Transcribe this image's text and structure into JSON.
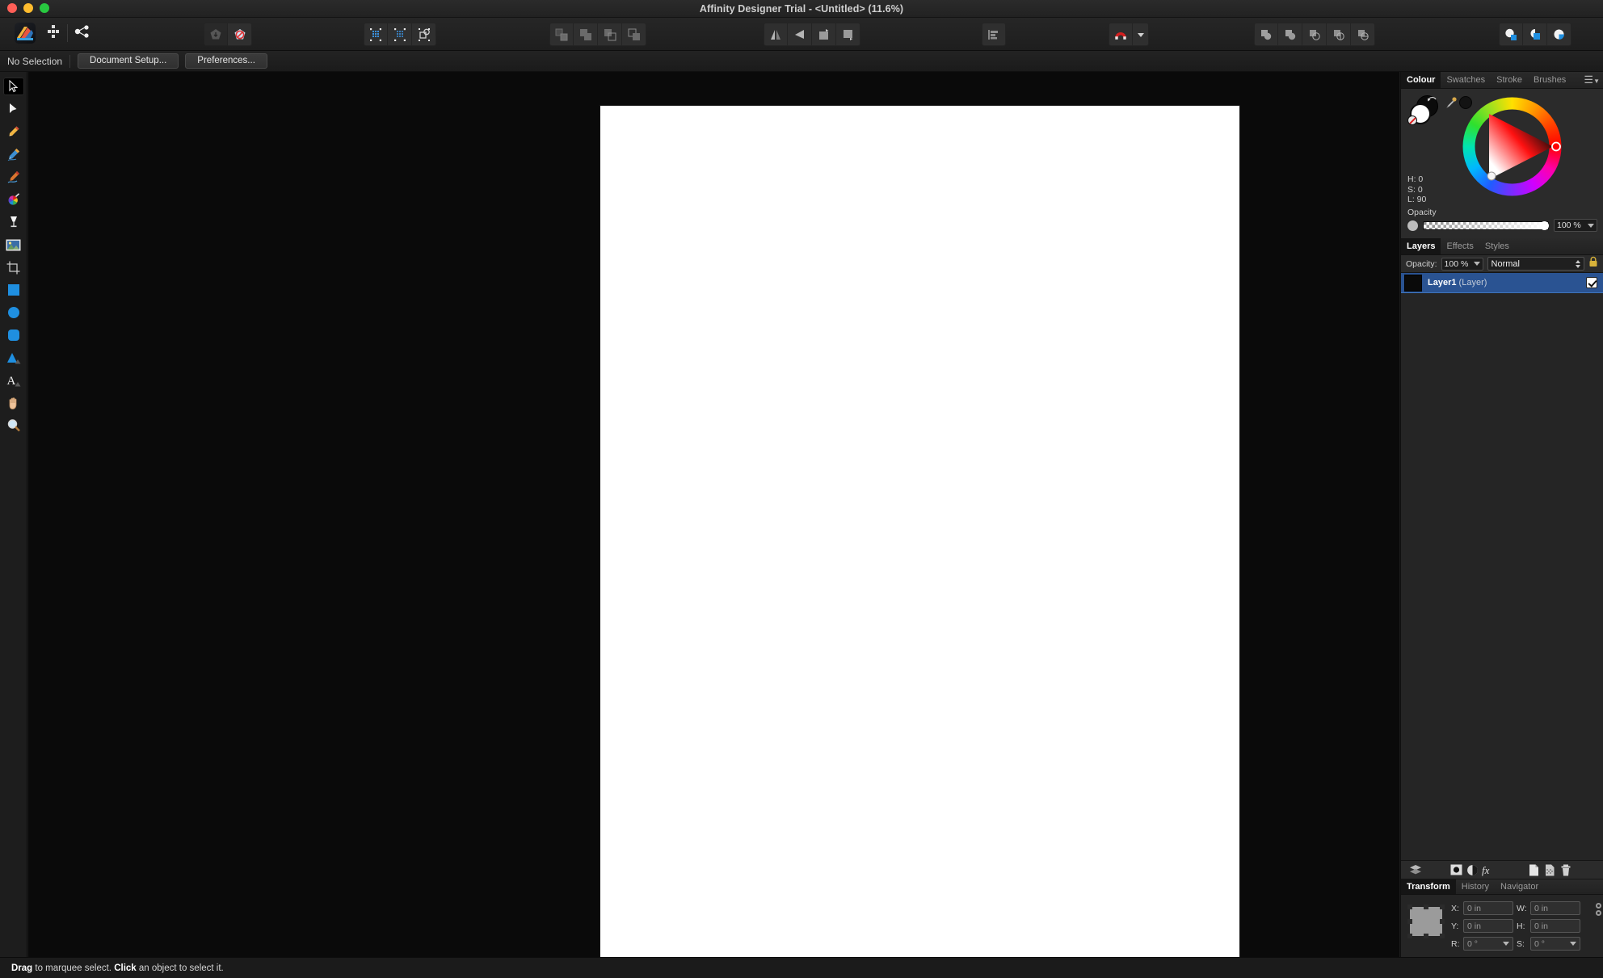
{
  "window": {
    "title": "Affinity Designer Trial - <Untitled> (11.6%)",
    "app_name": "Affinity Designer Trial",
    "document_name": "<Untitled>",
    "zoom_level": "11.6%",
    "traffic_lights": [
      "close",
      "minimize",
      "maximize"
    ]
  },
  "toolbar": {
    "left_group": [
      {
        "name": "affinity-designer-app-icon",
        "label": "Designer Persona"
      },
      {
        "name": "pixel-persona-icon",
        "label": "Pixel Persona"
      },
      {
        "name": "export-persona-icon",
        "label": "Export Persona"
      }
    ],
    "snapshot_group": [
      {
        "name": "add-snapshot-icon",
        "label": "Add Snapshot",
        "enabled": false
      },
      {
        "name": "restore-snapshot-icon",
        "label": "Restore Snapshot",
        "enabled": true
      }
    ],
    "selection_group": [
      {
        "name": "select-pixels-icon",
        "label": "Select Pixels"
      },
      {
        "name": "select-sampled-colour-icon",
        "label": "Select Sampled Colour"
      },
      {
        "name": "select-object-icon",
        "label": "Select Object"
      }
    ],
    "boolean_group": [
      {
        "name": "geometry-divide-icon",
        "label": "Divide"
      },
      {
        "name": "geometry-add-icon",
        "label": "Add"
      },
      {
        "name": "geometry-subtract-icon",
        "label": "Subtract"
      },
      {
        "name": "geometry-intersect-icon",
        "label": "Intersect"
      }
    ],
    "flip_group": [
      {
        "name": "flip-horizontal-icon",
        "label": "Flip Horizontal"
      },
      {
        "name": "flip-vertical-icon",
        "label": "Flip Vertical"
      },
      {
        "name": "rotate-ccw-icon",
        "label": "Rotate Anticlockwise"
      },
      {
        "name": "rotate-cw-icon",
        "label": "Rotate Clockwise"
      }
    ],
    "align_group": [
      {
        "name": "alignment-icon",
        "label": "Alignment"
      }
    ],
    "snapping_group": [
      {
        "name": "magnet-snapping-icon",
        "label": "Snapping"
      },
      {
        "name": "snapping-options-caret",
        "label": "Snapping Options"
      }
    ],
    "boolean_ops_group": [
      {
        "name": "boolean-add-icon",
        "label": "Add"
      },
      {
        "name": "boolean-subtract-icon",
        "label": "Subtract"
      },
      {
        "name": "boolean-intersect-icon",
        "label": "Intersect"
      },
      {
        "name": "boolean-divide-icon",
        "label": "Divide"
      },
      {
        "name": "boolean-combine-icon",
        "label": "Combine"
      }
    ],
    "persona_group": [
      {
        "name": "designer-persona-icon",
        "label": "Designer Persona"
      },
      {
        "name": "pixel-persona-icon",
        "label": "Pixel Persona"
      },
      {
        "name": "export-persona-icon",
        "label": "Export Persona"
      }
    ]
  },
  "context_bar": {
    "selection_status": "No Selection",
    "document_setup_label": "Document Setup...",
    "preferences_label": "Preferences..."
  },
  "tools": [
    {
      "name": "move-tool",
      "label": "Move Tool",
      "active": true
    },
    {
      "name": "node-tool",
      "label": "Node Tool",
      "active": false
    },
    {
      "name": "pen-tool",
      "label": "Pen Tool",
      "active": false
    },
    {
      "name": "pencil-tool",
      "label": "Pencil Tool",
      "active": false
    },
    {
      "name": "vector-brush-tool",
      "label": "Vector Brush Tool",
      "active": false
    },
    {
      "name": "colour-picker-tool",
      "label": "Colour Picker Tool",
      "active": false
    },
    {
      "name": "fill-tool",
      "label": "Fill Tool",
      "active": false
    },
    {
      "name": "place-image-tool",
      "label": "Place Image Tool",
      "active": false
    },
    {
      "name": "crop-tool",
      "label": "Crop Tool",
      "active": false
    },
    {
      "name": "rectangle-tool",
      "label": "Rectangle Tool",
      "active": false
    },
    {
      "name": "ellipse-tool",
      "label": "Ellipse Tool",
      "active": false
    },
    {
      "name": "rounded-rectangle-tool",
      "label": "Rounded Rectangle Tool",
      "active": false
    },
    {
      "name": "triangle-tool",
      "label": "Triangle Tool",
      "active": false
    },
    {
      "name": "artistic-text-tool",
      "label": "Artistic Text Tool",
      "active": false
    },
    {
      "name": "view-pan-tool",
      "label": "View Tool",
      "active": false
    },
    {
      "name": "zoom-tool",
      "label": "Zoom Tool",
      "active": false
    }
  ],
  "colour_panel": {
    "tabs": [
      {
        "label": "Colour",
        "selected": true
      },
      {
        "label": "Swatches",
        "selected": false
      },
      {
        "label": "Stroke",
        "selected": false
      },
      {
        "label": "Brushes",
        "selected": false
      }
    ],
    "fill_colour": "#ffffff",
    "stroke_colour": "#0b0b0b",
    "hue_label": "H: 0",
    "saturation_label": "S: 0",
    "lightness_label": "L: 90",
    "hue_value": 0,
    "saturation_value": 0,
    "lightness_value": 90,
    "opacity_label": "Opacity",
    "opacity_value": "100 %"
  },
  "layers_panel": {
    "tabs": [
      {
        "label": "Layers",
        "selected": true
      },
      {
        "label": "Effects",
        "selected": false
      },
      {
        "label": "Styles",
        "selected": false
      }
    ],
    "opacity_label": "Opacity:",
    "opacity_value": "100 %",
    "blend_mode": "Normal",
    "lock_icon": "lock-icon",
    "layers": [
      {
        "name": "Layer1",
        "type": "(Layer)",
        "visible": true,
        "selected": true
      }
    ],
    "actions": [
      {
        "name": "layer-stack-icon",
        "label": "Layers"
      },
      {
        "name": "mask-layer-icon",
        "label": "Mask Layer"
      },
      {
        "name": "adjustment-layer-icon",
        "label": "Adjustment Layer"
      },
      {
        "name": "layer-effects-icon",
        "label": "Layer Effects"
      },
      {
        "name": "add-layer-icon",
        "label": "Add Layer"
      },
      {
        "name": "add-pixel-layer-icon",
        "label": "Add Pixel Layer"
      },
      {
        "name": "delete-layer-icon",
        "label": "Delete Layer"
      }
    ]
  },
  "transform_panel": {
    "tabs": [
      {
        "label": "Transform",
        "selected": true
      },
      {
        "label": "History",
        "selected": false
      },
      {
        "label": "Navigator",
        "selected": false
      }
    ],
    "fields": {
      "x_label": "X:",
      "x_value": "0 in",
      "y_label": "Y:",
      "y_value": "0 in",
      "w_label": "W:",
      "w_value": "0 in",
      "h_label": "H:",
      "h_value": "0 in",
      "r_label": "R:",
      "r_value": "0 °",
      "s_label": "S:",
      "s_value": "0 °"
    }
  },
  "status_bar": {
    "hint_prefix_bold": "Drag",
    "hint_middle": " to marquee select. ",
    "hint_second_bold": "Click",
    "hint_suffix": " an object to select it."
  },
  "colors": {
    "chrome": "#252525",
    "canvas_background": "#0a0a0a",
    "page_white": "#ffffff",
    "selection_blue": "#2a5392",
    "accent_blue": "#1f8fe0"
  }
}
